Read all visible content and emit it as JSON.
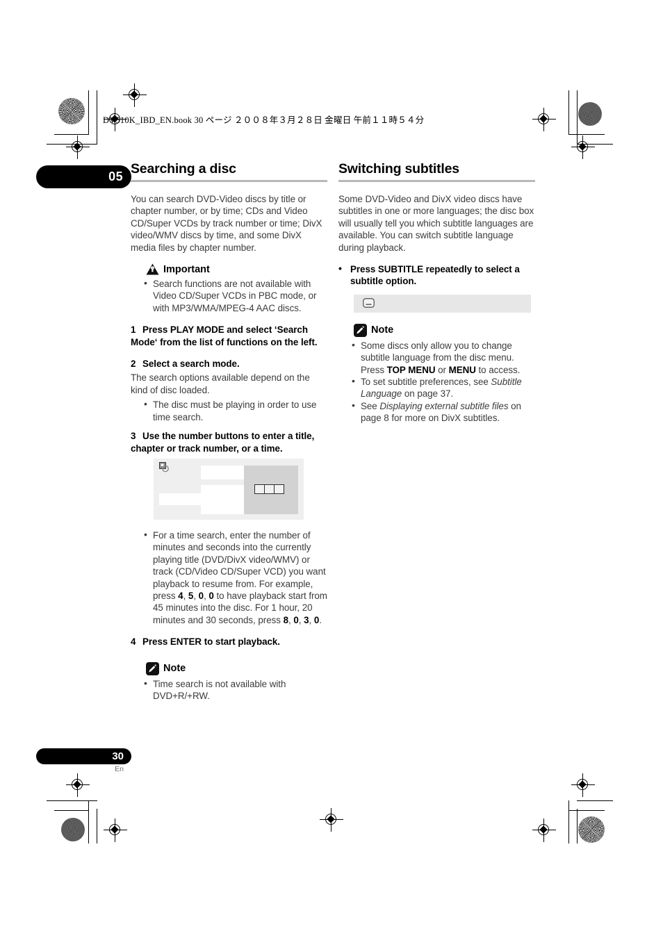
{
  "file_header": "DV510K_IBD_EN.book   30 ページ   ２００８年３月２８日   金曜日   午前１１時５４分",
  "chapter_tab": "05",
  "footer": {
    "page_number": "30",
    "language": "En"
  },
  "left_column": {
    "title": "Searching a disc",
    "intro": "You can search DVD-Video discs by title or chapter number, or by time; CDs and Video CD/Super VCDs by track number or time; DivX video/WMV discs by time, and some DivX media files by chapter number.",
    "important": {
      "label": "Important",
      "icon": "warning-triangle-icon",
      "bullets": [
        "Search functions are not available with Video CD/Super VCDs in PBC mode, or with MP3/WMA/MPEG-4 AAC discs."
      ]
    },
    "steps": [
      {
        "number": "1",
        "heading": "Press PLAY MODE and select ‘Search Mode‘ from the list of functions on the left."
      },
      {
        "number": "2",
        "heading": "Select a search mode.",
        "body": "The search options available depend on the kind of disc loaded.",
        "bullets": [
          "The disc must be playing in order to use time search."
        ]
      },
      {
        "number": "3",
        "heading": "Use the number buttons to enter a title, chapter or track number, or a time.",
        "bullets_after_figure": [
          "For a time search, enter the number of minutes and seconds into the currently playing title (DVD/DivX video/WMV) or track (CD/Video CD/Super VCD) you want playback to resume from. For example, press 4, 5, 0, 0 to have playback start from 45 minutes into the disc. For 1 hour, 20 minutes and 30 seconds, press 8, 0, 3, 0."
        ]
      },
      {
        "number": "4",
        "heading": "Press ENTER to start playback."
      }
    ],
    "figure": {
      "icon": "disc-tag-icon",
      "entry_box_count": 3
    },
    "note": {
      "label": "Note",
      "icon": "pencil-icon",
      "bullets": [
        "Time search is not available with DVD+R/+RW."
      ]
    }
  },
  "right_column": {
    "title": "Switching subtitles",
    "intro": "Some DVD-Video and DivX video discs have subtitles in one or more languages; the disc box will usually tell you which subtitle languages are available. You can switch subtitle language during playback.",
    "instruction": "Press SUBTITLE repeatedly to select a subtitle option.",
    "osd_bar": {
      "icon": "subtitle-display-icon"
    },
    "note": {
      "label": "Note",
      "icon": "pencil-icon",
      "bullets": [
        "Some discs only allow you to change subtitle language from the disc menu. Press TOP MENU or MENU to access.",
        "To set subtitle preferences, see Subtitle Language on page 37.",
        "See Displaying external subtitle files on page 8 for more on DivX subtitles."
      ]
    }
  },
  "colors": {
    "rule": "#b8b8b8",
    "body_text": "#3b3b3b",
    "heading_text": "#000000",
    "figure_bg": "#efefef",
    "figure_panel": "#d2d2d2",
    "osd_bar_bg": "#e7e7e7"
  }
}
